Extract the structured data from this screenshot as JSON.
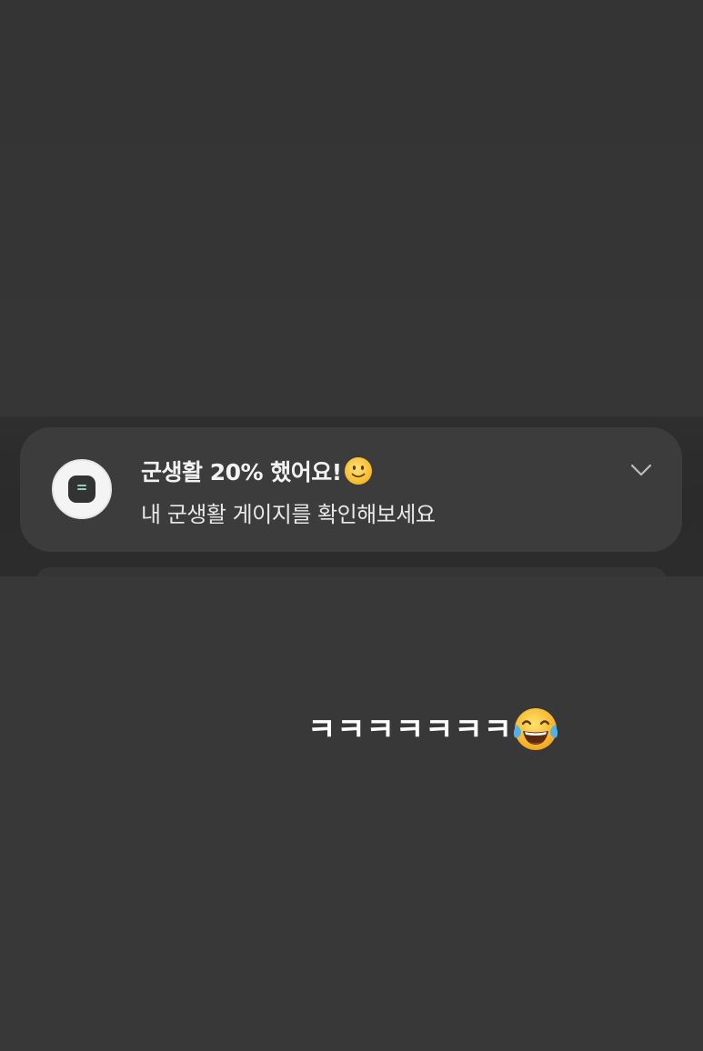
{
  "notification": {
    "app_icon": "app-logo-icon",
    "title": "군생활 20% 했어요!",
    "title_emoji": "slightly-smiling-face-emoji",
    "body": "내 군생활 게이지를 확인해보세요",
    "expand_icon": "chevron-down-icon"
  },
  "story_caption": {
    "text": "ㅋㅋㅋㅋㅋㅋㅋ",
    "emoji": "face-with-tears-of-joy-emoji"
  },
  "colors": {
    "background": "#333333",
    "card": "#3c3c3c",
    "icon_accent": "#8fd1b0",
    "text": "#f2f2f2"
  }
}
